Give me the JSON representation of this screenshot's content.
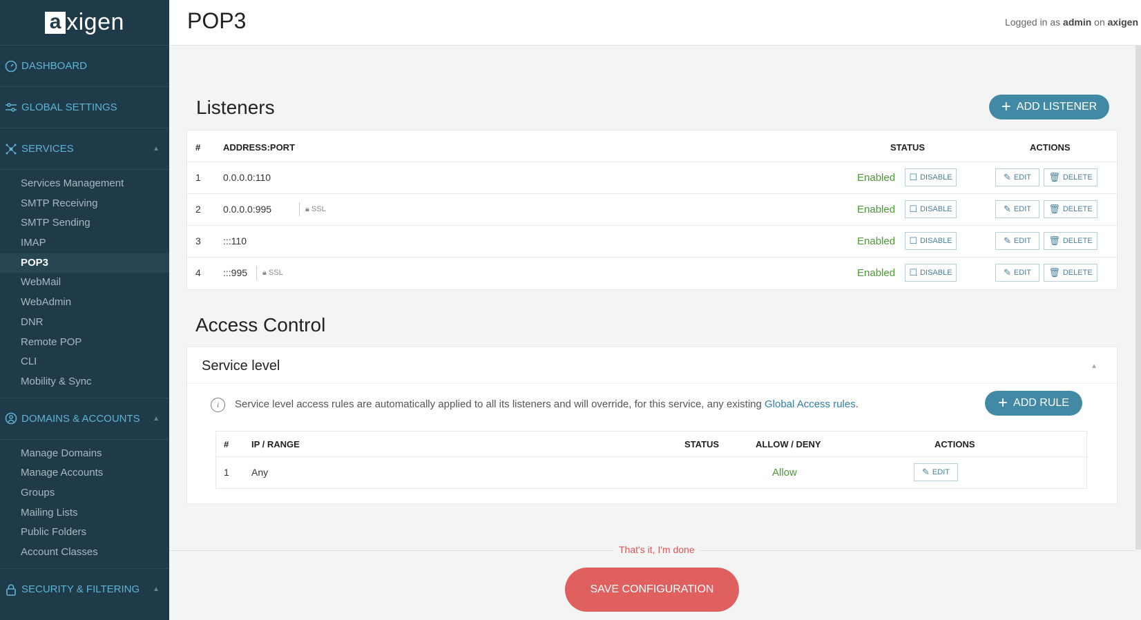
{
  "brand": {
    "logo_mark": "a",
    "logo_rest": "xigen"
  },
  "sidebar": {
    "sections": [
      {
        "label": "DASHBOARD",
        "icon": "dashboard-icon"
      },
      {
        "label": "GLOBAL SETTINGS",
        "icon": "sliders-icon"
      },
      {
        "label": "SERVICES",
        "icon": "network-icon",
        "expanded": true
      },
      {
        "label": "DOMAINS & ACCOUNTS",
        "icon": "globe-icon",
        "expanded": true
      },
      {
        "label": "SECURITY & FILTERING",
        "icon": "lock-icon",
        "expanded": true
      }
    ],
    "services_items": [
      "Services Management",
      "SMTP Receiving",
      "SMTP Sending",
      "IMAP",
      "POP3",
      "WebMail",
      "WebAdmin",
      "DNR",
      "Remote POP",
      "CLI",
      "Mobility & Sync"
    ],
    "services_active": "POP3",
    "domains_items": [
      "Manage Domains",
      "Manage Accounts",
      "Groups",
      "Mailing Lists",
      "Public Folders",
      "Account Classes"
    ]
  },
  "header": {
    "title": "POP3",
    "login_prefix": "Logged in as ",
    "login_user": "admin",
    "login_mid": " on ",
    "login_host": "axigen"
  },
  "listeners": {
    "title": "Listeners",
    "add_button": "ADD LISTENER",
    "columns": {
      "num": "#",
      "address": "ADDRESS:PORT",
      "status": "STATUS",
      "actions": "ACTIONS"
    },
    "rows": [
      {
        "num": "1",
        "address": "0.0.0.0:110",
        "ssl": "",
        "status": "Enabled"
      },
      {
        "num": "2",
        "address": "0.0.0.0:995",
        "ssl": "SSL",
        "status": "Enabled"
      },
      {
        "num": "3",
        "address": ":::110",
        "ssl": "",
        "status": "Enabled"
      },
      {
        "num": "4",
        "address": ":::995",
        "ssl": "SSL",
        "status": "Enabled"
      }
    ],
    "disable_label": "DISABLE",
    "edit_label": "EDIT",
    "delete_label": "DELETE"
  },
  "access_control": {
    "title_part1": "Access",
    "title_part2": " Control",
    "panel_title": "Service level",
    "info_text": "Service level access rules are automatically applied to all its listeners and will override, for this service, any existing ",
    "info_link": "Global Access rules",
    "info_end": ".",
    "add_rule_button": "ADD RULE",
    "columns": {
      "num": "#",
      "ip": "IP / RANGE",
      "status": "STATUS",
      "allow": "ALLOW / DENY",
      "actions": "ACTIONS"
    },
    "rows": [
      {
        "num": "1",
        "ip": "Any",
        "allow": "Allow",
        "edit": "EDIT"
      }
    ]
  },
  "footer": {
    "done_text": "That's it, I'm done",
    "save_button": "SAVE CONFIGURATION"
  },
  "colors": {
    "sidebar_bg": "#1f3a48",
    "accent": "#4289a6",
    "enabled_green": "#4a9a32",
    "save_red": "#e05f5f"
  }
}
